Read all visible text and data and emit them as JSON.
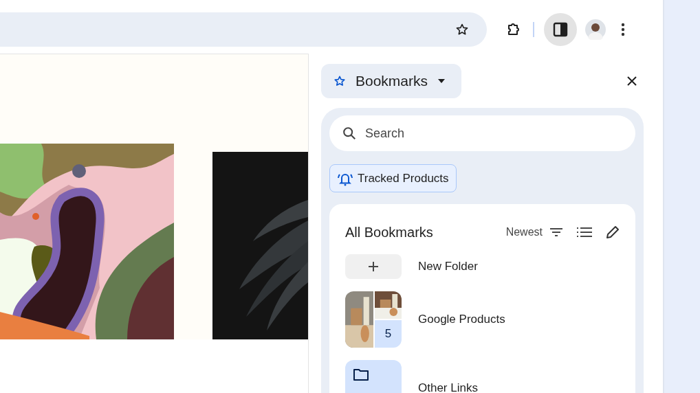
{
  "toolbar": {
    "side_panel_button": {
      "selected": true
    }
  },
  "side_panel": {
    "title": "Bookmarks",
    "search": {
      "placeholder": "Search"
    },
    "chip": {
      "label": "Tracked Products"
    },
    "list": {
      "heading": "All Bookmarks",
      "sort": "Newest",
      "items": [
        {
          "kind": "new",
          "label": "New Folder"
        },
        {
          "kind": "preview",
          "label": "Google Products",
          "count": "5"
        },
        {
          "kind": "folder",
          "label": "Other Links"
        }
      ]
    }
  }
}
